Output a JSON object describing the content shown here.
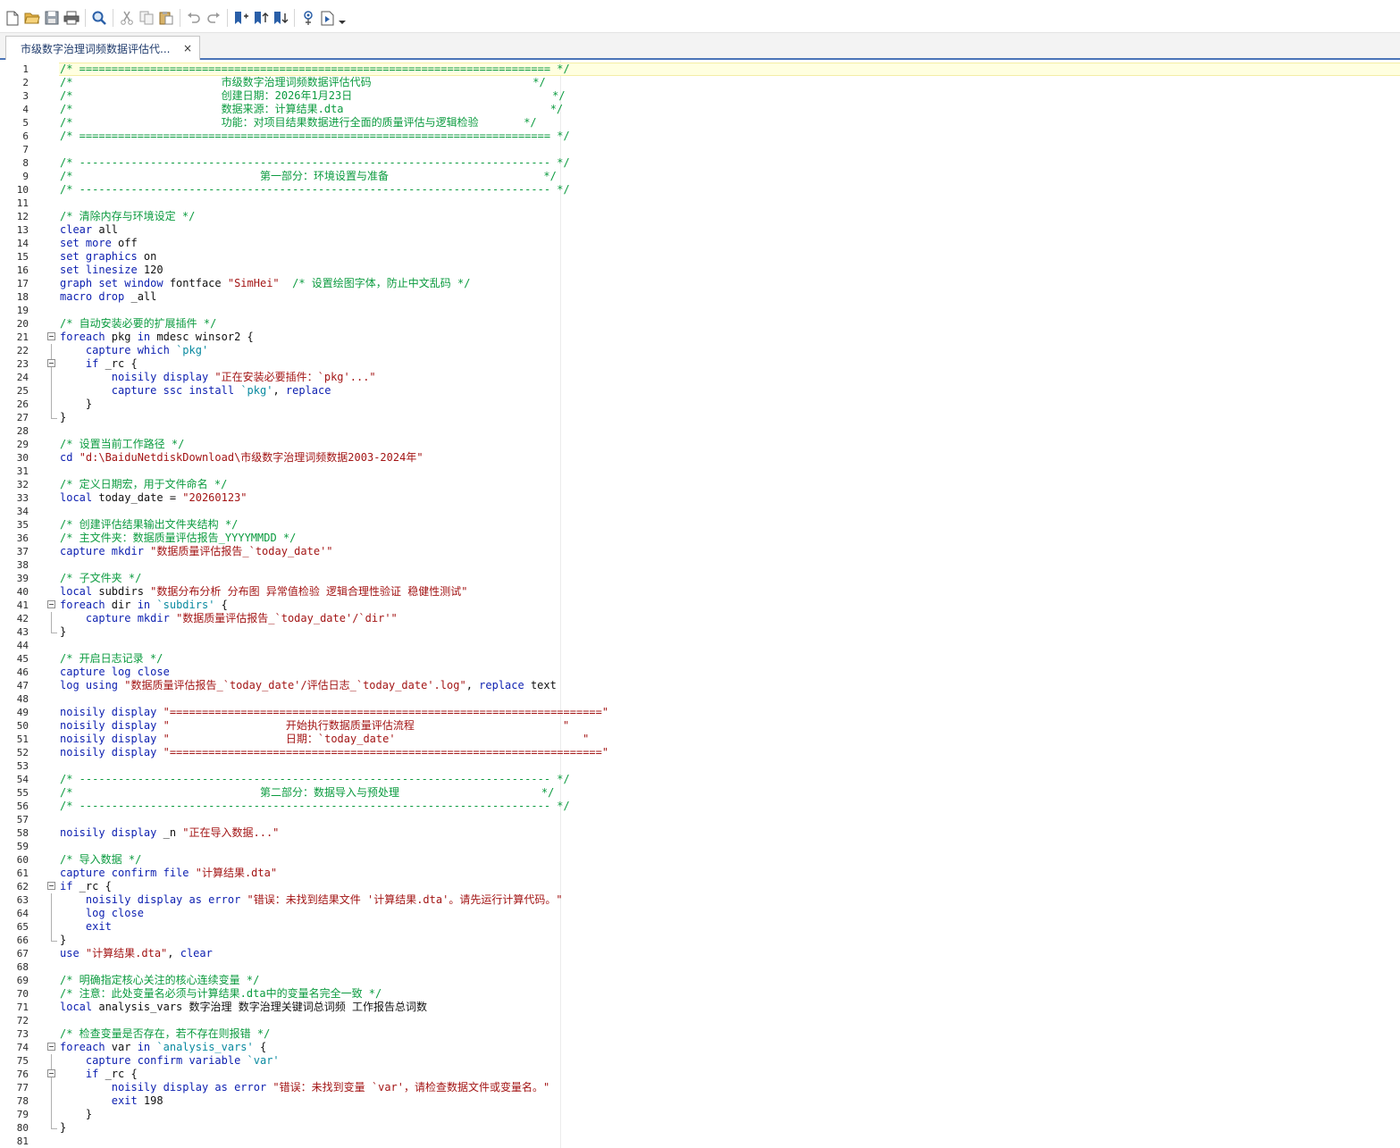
{
  "toolbar": {
    "buttons": [
      {
        "name": "new-file-icon",
        "tip": "New"
      },
      {
        "name": "open-folder-icon",
        "tip": "Open"
      },
      {
        "name": "save-icon",
        "tip": "Save"
      },
      {
        "name": "print-icon",
        "tip": "Print"
      },
      {
        "name": "sep"
      },
      {
        "name": "find-icon",
        "tip": "Find"
      },
      {
        "name": "sep"
      },
      {
        "name": "cut-icon",
        "tip": "Cut"
      },
      {
        "name": "copy-icon",
        "tip": "Copy"
      },
      {
        "name": "paste-icon",
        "tip": "Paste"
      },
      {
        "name": "sep"
      },
      {
        "name": "undo-icon",
        "tip": "Undo"
      },
      {
        "name": "redo-icon",
        "tip": "Redo"
      },
      {
        "name": "sep"
      },
      {
        "name": "toggle-bookmark-icon",
        "tip": "Toggle bookmark"
      },
      {
        "name": "previous-bookmark-icon",
        "tip": "Previous bookmark"
      },
      {
        "name": "next-bookmark-icon",
        "tip": "Next bookmark"
      },
      {
        "name": "sep"
      },
      {
        "name": "show-file-in-viewer-icon",
        "tip": "Show file in Viewer"
      },
      {
        "name": "execute-do-icon",
        "tip": "Execute (do)"
      },
      {
        "name": "dropdown-arrow-icon",
        "tip": "More"
      }
    ]
  },
  "tab": {
    "title": "市级数字治理词频数据评估代...",
    "close": "×"
  },
  "colors": {
    "comment": "#0b9b3f",
    "keyword": "#0c1fb0",
    "string": "#a31515",
    "macro": "#0a8aa0",
    "tab_accent": "#4a74b7",
    "current_line": "#ffffe0"
  },
  "editor": {
    "lines": [
      [
        [
          "c",
          "/* ========================================================================= */"
        ]
      ],
      [
        [
          "c",
          "/*                       市级数字治理词频数据评估代码                         */"
        ]
      ],
      [
        [
          "c",
          "/*                       创建日期：2026年1月23日                               */"
        ]
      ],
      [
        [
          "c",
          "/*                       数据来源：计算结果.dta                                */"
        ]
      ],
      [
        [
          "c",
          "/*                       功能：对项目结果数据进行全面的质量评估与逻辑检验       */"
        ]
      ],
      [
        [
          "c",
          "/* ========================================================================= */"
        ]
      ],
      [],
      [
        [
          "c",
          "/* ------------------------------------------------------------------------- */"
        ]
      ],
      [
        [
          "c",
          "/*                             第一部分：环境设置与准备                        */"
        ]
      ],
      [
        [
          "c",
          "/* ------------------------------------------------------------------------- */"
        ]
      ],
      [],
      [
        [
          "c",
          "/* 清除内存与环境设定 */"
        ]
      ],
      [
        [
          "k",
          "clear"
        ],
        [
          "t",
          " all"
        ]
      ],
      [
        [
          "k",
          "set more"
        ],
        [
          "t",
          " off"
        ]
      ],
      [
        [
          "k",
          "set graphics"
        ],
        [
          "t",
          " on"
        ]
      ],
      [
        [
          "k",
          "set linesize"
        ],
        [
          "t",
          " 120"
        ]
      ],
      [
        [
          "k",
          "graph set window"
        ],
        [
          "t",
          " fontface "
        ],
        [
          "s",
          "\"SimHei\""
        ],
        [
          "t",
          "  "
        ],
        [
          "c",
          "/* 设置绘图字体，防止中文乱码 */"
        ]
      ],
      [
        [
          "k",
          "macro drop"
        ],
        [
          "t",
          " _all"
        ]
      ],
      [],
      [
        [
          "c",
          "/* 自动安装必要的扩展插件 */"
        ]
      ],
      [
        [
          "k",
          "foreach"
        ],
        [
          "t",
          " pkg "
        ],
        [
          "k",
          "in"
        ],
        [
          "t",
          " mdesc winsor2 {"
        ]
      ],
      [
        [
          "t",
          "    "
        ],
        [
          "k",
          "capture which"
        ],
        [
          "t",
          " "
        ],
        [
          "m",
          "`pkg'"
        ]
      ],
      [
        [
          "t",
          "    "
        ],
        [
          "k",
          "if"
        ],
        [
          "t",
          " _rc {"
        ]
      ],
      [
        [
          "t",
          "        "
        ],
        [
          "k",
          "noisily display"
        ],
        [
          "t",
          " "
        ],
        [
          "s",
          "\"正在安装必要插件：`pkg'...\""
        ]
      ],
      [
        [
          "t",
          "        "
        ],
        [
          "k",
          "capture ssc install"
        ],
        [
          "t",
          " "
        ],
        [
          "m",
          "`pkg'"
        ],
        [
          "t",
          ", "
        ],
        [
          "k",
          "replace"
        ]
      ],
      [
        [
          "t",
          "    }"
        ]
      ],
      [
        [
          "t",
          "}"
        ]
      ],
      [],
      [
        [
          "c",
          "/* 设置当前工作路径 */"
        ]
      ],
      [
        [
          "k",
          "cd"
        ],
        [
          "t",
          " "
        ],
        [
          "s",
          "\"d:\\BaiduNetdiskDownload\\市级数字治理词频数据2003-2024年\""
        ]
      ],
      [],
      [
        [
          "c",
          "/* 定义日期宏，用于文件命名 */"
        ]
      ],
      [
        [
          "k",
          "local"
        ],
        [
          "t",
          " today_date = "
        ],
        [
          "s",
          "\"20260123\""
        ]
      ],
      [],
      [
        [
          "c",
          "/* 创建评估结果输出文件夹结构 */"
        ]
      ],
      [
        [
          "c",
          "/* 主文件夹：数据质量评估报告_YYYYMMDD */"
        ]
      ],
      [
        [
          "k",
          "capture mkdir"
        ],
        [
          "t",
          " "
        ],
        [
          "s",
          "\"数据质量评估报告_`today_date'\""
        ]
      ],
      [],
      [
        [
          "c",
          "/* 子文件夹 */"
        ]
      ],
      [
        [
          "k",
          "local"
        ],
        [
          "t",
          " subdirs "
        ],
        [
          "s",
          "\"数据分布分析 分布图 异常值检验 逻辑合理性验证 稳健性测试\""
        ]
      ],
      [
        [
          "k",
          "foreach"
        ],
        [
          "t",
          " dir "
        ],
        [
          "k",
          "in"
        ],
        [
          "t",
          " "
        ],
        [
          "m",
          "`subdirs'"
        ],
        [
          "t",
          " {"
        ]
      ],
      [
        [
          "t",
          "    "
        ],
        [
          "k",
          "capture mkdir"
        ],
        [
          "t",
          " "
        ],
        [
          "s",
          "\"数据质量评估报告_`today_date'/`dir'\""
        ]
      ],
      [
        [
          "t",
          "}"
        ]
      ],
      [],
      [
        [
          "c",
          "/* 开启日志记录 */"
        ]
      ],
      [
        [
          "k",
          "capture log close"
        ]
      ],
      [
        [
          "k",
          "log using"
        ],
        [
          "t",
          " "
        ],
        [
          "s",
          "\"数据质量评估报告_`today_date'/评估日志_`today_date'.log\""
        ],
        [
          "t",
          ", "
        ],
        [
          "k",
          "replace"
        ],
        [
          "t",
          " text"
        ]
      ],
      [],
      [
        [
          "k",
          "noisily display"
        ],
        [
          "t",
          " "
        ],
        [
          "s",
          "\"===================================================================\""
        ]
      ],
      [
        [
          "k",
          "noisily display"
        ],
        [
          "t",
          " "
        ],
        [
          "s",
          "\"                  开始执行数据质量评估流程                       \""
        ]
      ],
      [
        [
          "k",
          "noisily display"
        ],
        [
          "t",
          " "
        ],
        [
          "s",
          "\"                  日期：`today_date'                             \""
        ]
      ],
      [
        [
          "k",
          "noisily display"
        ],
        [
          "t",
          " "
        ],
        [
          "s",
          "\"===================================================================\""
        ]
      ],
      [],
      [
        [
          "c",
          "/* ------------------------------------------------------------------------- */"
        ]
      ],
      [
        [
          "c",
          "/*                             第二部分：数据导入与预处理                      */"
        ]
      ],
      [
        [
          "c",
          "/* ------------------------------------------------------------------------- */"
        ]
      ],
      [],
      [
        [
          "k",
          "noisily display"
        ],
        [
          "t",
          " _n "
        ],
        [
          "s",
          "\"正在导入数据...\""
        ]
      ],
      [],
      [
        [
          "c",
          "/* 导入数据 */"
        ]
      ],
      [
        [
          "k",
          "capture confirm file"
        ],
        [
          "t",
          " "
        ],
        [
          "s",
          "\"计算结果.dta\""
        ]
      ],
      [
        [
          "k",
          "if"
        ],
        [
          "t",
          " _rc {"
        ]
      ],
      [
        [
          "t",
          "    "
        ],
        [
          "k",
          "noisily display as error"
        ],
        [
          "t",
          " "
        ],
        [
          "s",
          "\"错误：未找到结果文件 '计算结果.dta'。请先运行计算代码。\""
        ]
      ],
      [
        [
          "t",
          "    "
        ],
        [
          "k",
          "log close"
        ]
      ],
      [
        [
          "t",
          "    "
        ],
        [
          "k",
          "exit"
        ]
      ],
      [
        [
          "t",
          "}"
        ]
      ],
      [
        [
          "k",
          "use"
        ],
        [
          "t",
          " "
        ],
        [
          "s",
          "\"计算结果.dta\""
        ],
        [
          "t",
          ", "
        ],
        [
          "k",
          "clear"
        ]
      ],
      [],
      [
        [
          "c",
          "/* 明确指定核心关注的核心连续变量 */"
        ]
      ],
      [
        [
          "c",
          "/* 注意：此处变量名必须与计算结果.dta中的变量名完全一致 */"
        ]
      ],
      [
        [
          "k",
          "local"
        ],
        [
          "t",
          " analysis_vars 数字治理 数字治理关键词总词频 工作报告总词数"
        ]
      ],
      [],
      [
        [
          "c",
          "/* 检查变量是否存在，若不存在则报错 */"
        ]
      ],
      [
        [
          "k",
          "foreach"
        ],
        [
          "t",
          " var "
        ],
        [
          "k",
          "in"
        ],
        [
          "t",
          " "
        ],
        [
          "m",
          "`analysis_vars'"
        ],
        [
          "t",
          " {"
        ]
      ],
      [
        [
          "t",
          "    "
        ],
        [
          "k",
          "capture confirm variable"
        ],
        [
          "t",
          " "
        ],
        [
          "m",
          "`var'"
        ]
      ],
      [
        [
          "t",
          "    "
        ],
        [
          "k",
          "if"
        ],
        [
          "t",
          " _rc {"
        ]
      ],
      [
        [
          "t",
          "        "
        ],
        [
          "k",
          "noisily display as error"
        ],
        [
          "t",
          " "
        ],
        [
          "s",
          "\"错误：未找到变量 `var'，请检查数据文件或变量名。\""
        ]
      ],
      [
        [
          "t",
          "        "
        ],
        [
          "k",
          "exit"
        ],
        [
          "t",
          " 198"
        ]
      ],
      [
        [
          "t",
          "    }"
        ]
      ],
      [
        [
          "t",
          "}"
        ]
      ],
      []
    ]
  }
}
